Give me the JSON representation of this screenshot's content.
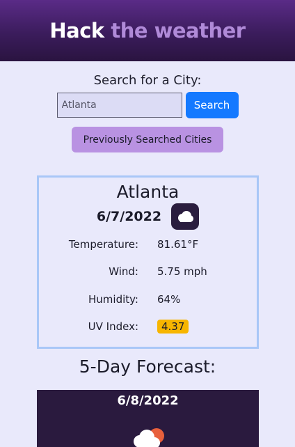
{
  "header": {
    "brand_hack": "Hack",
    "brand_rest": "the weather"
  },
  "search": {
    "label": "Search for a City:",
    "input_value": "Atlanta",
    "button_label": "Search",
    "history_button_label": "Previously Searched Cities"
  },
  "current": {
    "city": "Atlanta",
    "date": "6/7/2022",
    "icon": "cloud-icon",
    "stats": {
      "temperature_label": "Temperature:",
      "temperature_value": "81.61°F",
      "wind_label": "Wind:",
      "wind_value": "5.75 mph",
      "humidity_label": "Humidity:",
      "humidity_value": "64%",
      "uv_label": "UV Index:",
      "uv_value": "4.37"
    }
  },
  "forecast": {
    "title": "5-Day Forecast:",
    "days": [
      {
        "date": "6/8/2022",
        "icon": "partly-cloudy-icon"
      }
    ]
  },
  "colors": {
    "header_top": "#5a2b87",
    "accent_blue": "#1479ff",
    "history_button": "#b992e2",
    "card_border": "#a9c7f7",
    "uv_badge": "#f7b500",
    "forecast_card": "#2a1a3e"
  }
}
